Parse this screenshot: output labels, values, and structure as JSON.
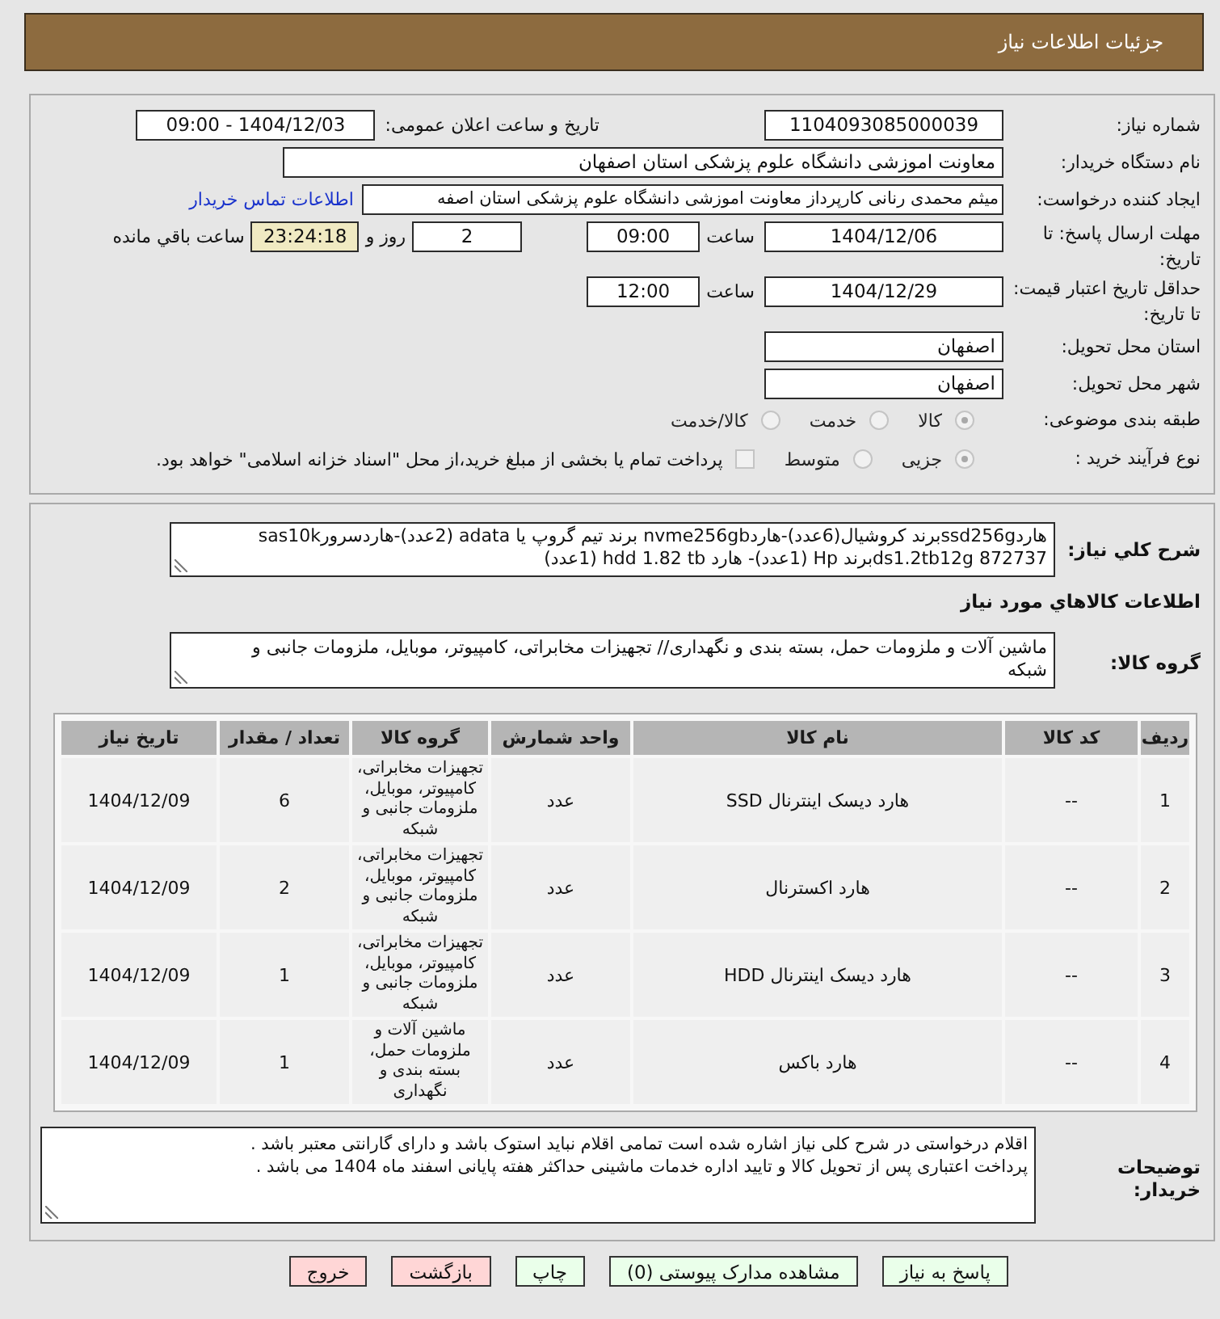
{
  "header": {
    "title": "جزئیات اطلاعات نیاز"
  },
  "details": {
    "need_number": {
      "label": "شماره نیاز:",
      "value": "1104093085000039"
    },
    "announce": {
      "label": "تاریخ و ساعت اعلان عمومی:",
      "value": "1404/12/03 - 09:00"
    },
    "buyer_org": {
      "label": "نام دستگاه خریدار:",
      "value": "معاونت اموزشی دانشگاه علوم پزشکی استان اصفهان"
    },
    "creator": {
      "label": "ایجاد کننده درخواست:",
      "value": "میثم محمدی رنانی کارپرداز معاونت اموزشی دانشگاه علوم پزشکی استان اصفه",
      "link": "اطلاعات تماس خریدار"
    },
    "reply_deadline": {
      "label": "مهلت ارسال پاسخ: تا تاریخ:",
      "date": "1404/12/06",
      "time_label": "ساعت",
      "time": "09:00",
      "days": "2",
      "days_label": "روز و",
      "remaining": "23:24:18",
      "remaining_label": "ساعت باقي مانده"
    },
    "price_validity": {
      "label": "حداقل تاریخ اعتبار قیمت: تا تاریخ:",
      "date": "1404/12/29",
      "time_label": "ساعت",
      "time": "12:00"
    },
    "province": {
      "label": "استان محل تحویل:",
      "value": "اصفهان"
    },
    "city": {
      "label": "شهر محل تحویل:",
      "value": "اصفهان"
    },
    "category": {
      "label": "طبقه بندی موضوعی:",
      "options": [
        {
          "label": "کالا",
          "selected": true,
          "disabled": true
        },
        {
          "label": "خدمت",
          "selected": false,
          "disabled": true
        },
        {
          "label": "کالا/خدمت",
          "selected": false,
          "disabled": true
        }
      ]
    },
    "process": {
      "label": "نوع فرآیند خرید :",
      "options": [
        {
          "label": "جزیی",
          "selected": true,
          "disabled": true
        },
        {
          "label": "متوسط",
          "selected": false,
          "disabled": true
        }
      ],
      "treasury": {
        "label": "پرداخت تمام یا بخشی از مبلغ خرید،از محل \"اسناد خزانه اسلامی\" خواهد بود.",
        "checked": false,
        "disabled": true
      }
    }
  },
  "need": {
    "description_label": "شرح کلي نياز:",
    "description": "هاردssd256gبرند کروشیال(6عدد)-هاردnvme256gb برند تیم گروپ یا adata (2عدد)-هاردسرورsas10k ds1.2tb12g 872737برند Hp (1عدد)- هارد hdd 1.82 tb  (1عدد)",
    "goods_heading": "اطلاعات کالاهاي مورد نياز",
    "group_label": "گروه کالا:",
    "group": "ماشین آلات و ملزومات حمل، بسته بندی و نگهداری// تجهیزات مخابراتی، کامپیوتر، موبایل، ملزومات جانبی و شبکه"
  },
  "table": {
    "columns": [
      "ردیف",
      "کد کالا",
      "نام کالا",
      "واحد شمارش",
      "گروه کالا",
      "تعداد / مقدار",
      "تاریخ نیاز"
    ],
    "rows": [
      [
        "1",
        "--",
        "هارد دیسک اینترنال SSD",
        "عدد",
        "تجهیزات مخابراتی، کامپیوتر، موبایل، ملزومات جانبی و شبکه",
        "6",
        "1404/12/09"
      ],
      [
        "2",
        "--",
        "هارد اکسترنال",
        "عدد",
        "تجهیزات مخابراتی، کامپیوتر، موبایل، ملزومات جانبی و شبکه",
        "2",
        "1404/12/09"
      ],
      [
        "3",
        "--",
        "هارد دیسک اینترنال HDD",
        "عدد",
        "تجهیزات مخابراتی، کامپیوتر، موبایل، ملزومات جانبی و شبکه",
        "1",
        "1404/12/09"
      ],
      [
        "4",
        "--",
        "هارد باکس",
        "عدد",
        "ماشین آلات و ملزومات حمل، بسته بندی و نگهداری",
        "1",
        "1404/12/09"
      ]
    ]
  },
  "buyer_notes": {
    "label": "توضیحات خریدار:",
    "lines": [
      "اقلام درخواستی در شرح کلی نیاز اشاره شده است تمامی اقلام نباید استوک باشد و دارای گارانتی معتبر باشد .",
      "پرداخت اعتباری پس از تحویل کالا و تایید اداره خدمات ماشینی حداکثر هفته پایانی اسفند ماه 1404 می باشد ."
    ]
  },
  "buttons": [
    {
      "label": "پاسخ به نیاز",
      "kind": "action"
    },
    {
      "label": "مشاهده مدارک پیوستی (0)",
      "kind": "action"
    },
    {
      "label": "چاپ",
      "kind": "action"
    },
    {
      "label": "بازگشت",
      "kind": "exit"
    },
    {
      "label": "خروج",
      "kind": "exit"
    }
  ]
}
